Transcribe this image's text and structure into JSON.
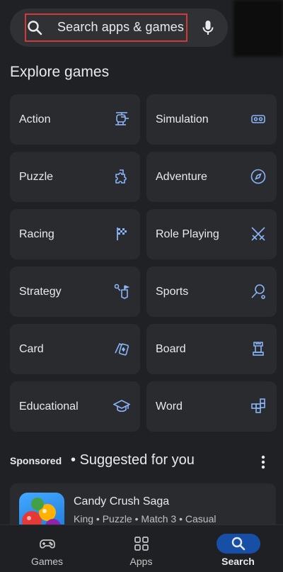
{
  "search": {
    "placeholder": "Search apps & games"
  },
  "explore": {
    "title": "Explore games"
  },
  "categories": [
    {
      "label": "Action",
      "icon": "helicopter-icon"
    },
    {
      "label": "Simulation",
      "icon": "vr-headset-icon"
    },
    {
      "label": "Puzzle",
      "icon": "puzzle-piece-icon"
    },
    {
      "label": "Adventure",
      "icon": "compass-icon"
    },
    {
      "label": "Racing",
      "icon": "checkered-flag-icon"
    },
    {
      "label": "Role Playing",
      "icon": "crossed-swords-icon"
    },
    {
      "label": "Strategy",
      "icon": "strategy-icon"
    },
    {
      "label": "Sports",
      "icon": "racket-icon"
    },
    {
      "label": "Card",
      "icon": "cards-icon"
    },
    {
      "label": "Board",
      "icon": "chess-rook-icon"
    },
    {
      "label": "Educational",
      "icon": "graduation-cap-icon"
    },
    {
      "label": "Word",
      "icon": "crossword-icon"
    }
  ],
  "suggested": {
    "sponsored_label": "Sponsored",
    "separator": "•",
    "title": "Suggested for you"
  },
  "app": {
    "name": "Candy Crush Saga",
    "meta": "King • Puzzle • Match 3 • Casual"
  },
  "nav": [
    {
      "label": "Games",
      "icon": "gamepad-icon",
      "active": false
    },
    {
      "label": "Apps",
      "icon": "apps-grid-icon",
      "active": false
    },
    {
      "label": "Search",
      "icon": "search-icon",
      "active": true
    }
  ],
  "colors": {
    "background": "#202124",
    "tile": "#2a2b2e",
    "accent": "#8ab4f8",
    "highlight": "#d23a3a"
  }
}
